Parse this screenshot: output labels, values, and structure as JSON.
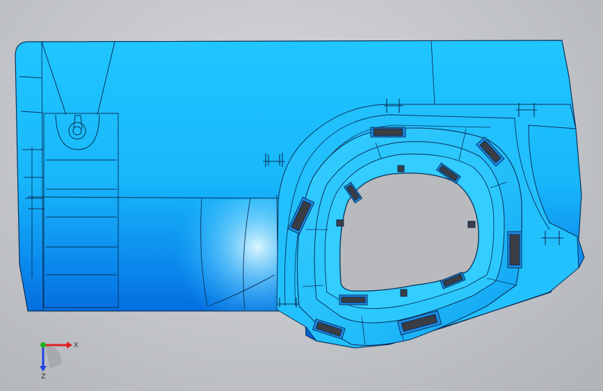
{
  "viewport": {
    "background_top": "#d6d8dc",
    "background_bottom": "#b0b3b8"
  },
  "model": {
    "body_color": "#1ec2ff",
    "shade_color": "#0060d8",
    "highlight_color": "#bff2ff",
    "edge_color": "#0a2f5a",
    "slot_color": "#3a3d44",
    "opening_color": "#b8babd"
  },
  "triad": {
    "x_label": "X",
    "z_label": "Z",
    "x_color": "#e02020",
    "y_color": "#20b020",
    "z_color": "#2040e0"
  }
}
